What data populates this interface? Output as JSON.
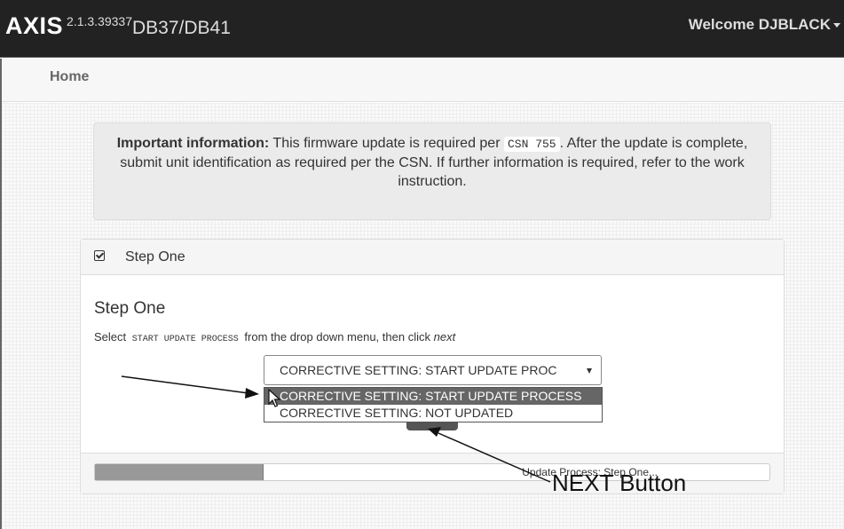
{
  "navbar": {
    "brand": "AXIS",
    "version": "2.1.3.39337",
    "model": "DB37/DB41",
    "welcome": "Welcome DJBLACK"
  },
  "breadcrumb": {
    "home": "Home"
  },
  "alert": {
    "strong": "Important information:",
    "text_before": "This firmware update is required per",
    "code": "CSN 755",
    "text_after": ". After the update is complete, submit unit identification as required per the CSN. If further information is required, refer to the work instruction."
  },
  "panel": {
    "heading_icon": "check-square-icon",
    "heading_title": "Step One",
    "step_title": "Step One",
    "desc_prefix": "Select",
    "desc_code": "START UPDATE PROCESS",
    "desc_middle": "from the drop down menu, then click",
    "desc_next": "next",
    "select_value": "CORRECTIVE SETTING: START UPDATE PROC",
    "dropdown_options": [
      "CORRECTIVE SETTING: START UPDATE PROCESS",
      "CORRECTIVE SETTING: NOT UPDATED"
    ],
    "progress_label": "Update Process: Step One...",
    "progress_percent": 25
  },
  "annotation": {
    "label": "NEXT Button"
  },
  "colors": {
    "navbar": "#222222",
    "highlight": "#666666",
    "progress_fill": "#999999"
  }
}
